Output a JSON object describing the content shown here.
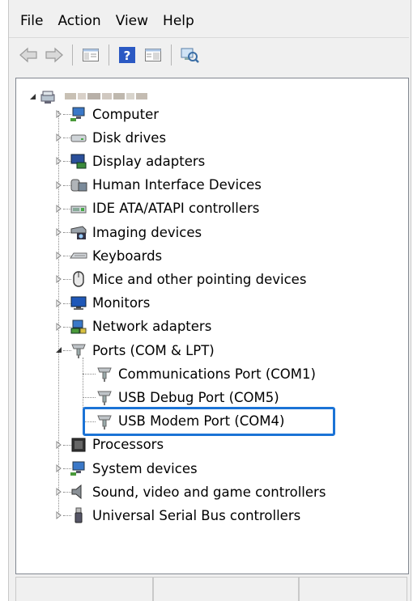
{
  "menu": {
    "file": "File",
    "action": "Action",
    "view": "View",
    "help": "Help"
  },
  "toolbar": {
    "icons": [
      "back-icon",
      "forward-icon",
      "show-hide-console-tree-icon",
      "help-icon",
      "properties-icon",
      "scan-hardware-icon"
    ]
  },
  "tree": {
    "root_label": "",
    "items": [
      {
        "label": "Computer",
        "icon": "computer-icon"
      },
      {
        "label": "Disk drives",
        "icon": "disk-drive-icon"
      },
      {
        "label": "Display adapters",
        "icon": "display-adapter-icon"
      },
      {
        "label": "Human Interface Devices",
        "icon": "hid-icon"
      },
      {
        "label": "IDE ATA/ATAPI controllers",
        "icon": "ide-controller-icon"
      },
      {
        "label": "Imaging devices",
        "icon": "imaging-device-icon"
      },
      {
        "label": "Keyboards",
        "icon": "keyboard-icon"
      },
      {
        "label": "Mice and other pointing devices",
        "icon": "mouse-icon"
      },
      {
        "label": "Monitors",
        "icon": "monitor-icon"
      },
      {
        "label": "Network adapters",
        "icon": "network-adapter-icon"
      },
      {
        "label": "Ports (COM & LPT)",
        "icon": "port-icon"
      },
      {
        "label": "Processors",
        "icon": "processor-icon"
      },
      {
        "label": "System devices",
        "icon": "system-device-icon"
      },
      {
        "label": "Sound, video and game controllers",
        "icon": "speaker-icon"
      },
      {
        "label": "Universal Serial Bus controllers",
        "icon": "usb-icon"
      }
    ],
    "ports_children": [
      {
        "label": "Communications Port (COM1)",
        "icon": "port-icon"
      },
      {
        "label": "USB Debug Port (COM5)",
        "icon": "port-icon"
      },
      {
        "label": "USB Modem Port (COM4)",
        "icon": "port-icon",
        "highlighted": true
      }
    ]
  },
  "colors": {
    "highlight": "#1b73d6",
    "background": "#f0f0f0",
    "tree_bg": "#ffffff"
  }
}
